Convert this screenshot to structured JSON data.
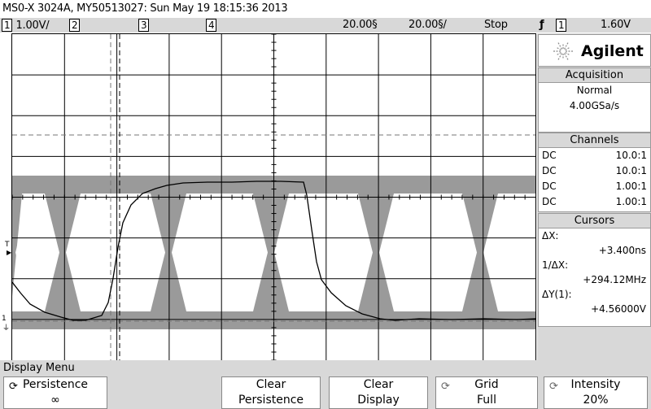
{
  "title": "MS0-X 3024A, MY50513027: Sun May 19 18:15:36 2013",
  "status": {
    "ch1_label": "1",
    "ch1_scale": "1.00V/",
    "ch2_label": "2",
    "ch3_label": "3",
    "ch4_label": "4",
    "timebase": "20.00§",
    "delay": "20.00§/",
    "run_state": "Stop",
    "trigger_icon": "ƒ",
    "trigger_source": "1",
    "trigger_level": "1.60V"
  },
  "brand": "Agilent",
  "acquisition": {
    "title": "Acquisition",
    "mode": "Normal",
    "rate": "4.00GSa/s"
  },
  "channels": {
    "title": "Channels",
    "rows": [
      {
        "coupling": "DC",
        "probe": "10.0:1"
      },
      {
        "coupling": "DC",
        "probe": "10.0:1"
      },
      {
        "coupling": "DC",
        "probe": "1.00:1"
      },
      {
        "coupling": "DC",
        "probe": "1.00:1"
      }
    ]
  },
  "cursors": {
    "title": "Cursors",
    "dx_label": "ΔX:",
    "dx_value": "+3.400ns",
    "inv_dx_label": "1/ΔX:",
    "inv_dx_value": "+294.12MHz",
    "dy_label": "ΔY(1):",
    "dy_value": "+4.56000V"
  },
  "menu": {
    "title": "Display Menu",
    "keys": [
      {
        "l1": "Persistence",
        "l2": "∞"
      },
      {
        "l1": "Clear",
        "l2": "Persistence"
      },
      {
        "l1": "Clear",
        "l2": "Display"
      },
      {
        "l1": "Grid",
        "l2": "Full"
      },
      {
        "l1": "Intensity",
        "l2": "20%"
      }
    ]
  },
  "markers": {
    "trigger_T": "T",
    "ground": "1"
  },
  "colors": {
    "panel": "#d8d8d8",
    "trace": "#000000",
    "persistence": "#9a9a9a",
    "grid": "#000000"
  }
}
